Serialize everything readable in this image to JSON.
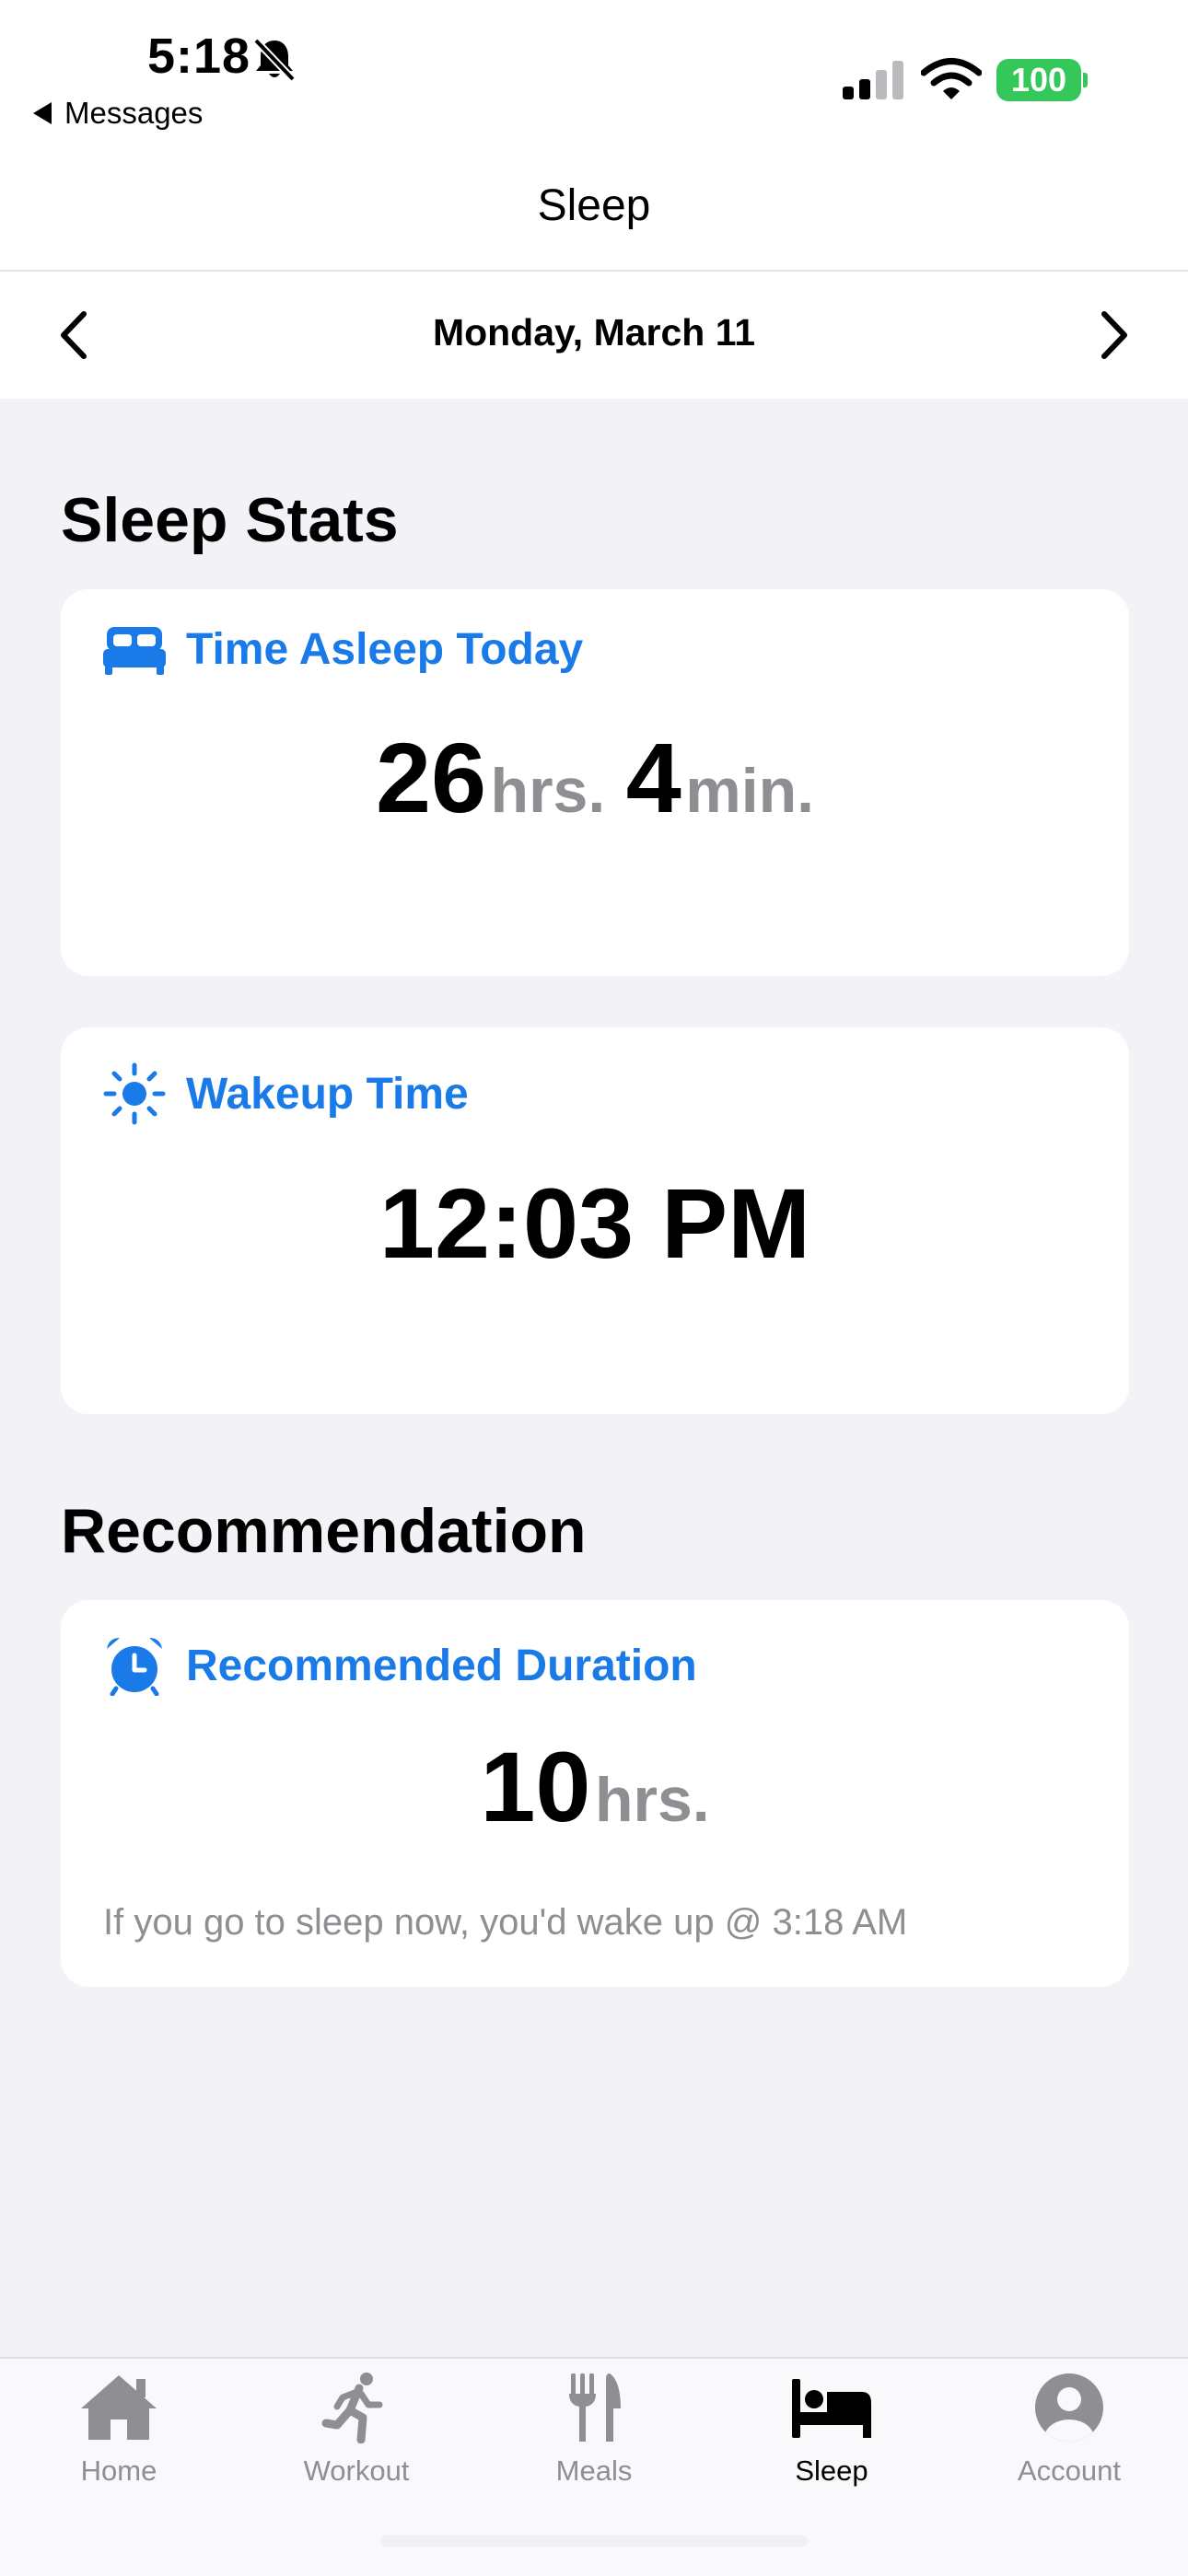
{
  "status_bar": {
    "time": "5:18",
    "back_label": "Messages",
    "battery": "100"
  },
  "nav": {
    "title": "Sleep",
    "date": "Monday, March 11"
  },
  "sleep_stats": {
    "heading": "Sleep Stats",
    "time_asleep": {
      "title": "Time Asleep Today",
      "hours": "26",
      "hours_unit": "hrs.",
      "minutes": "4",
      "minutes_unit": "min."
    },
    "wakeup": {
      "title": "Wakeup Time",
      "value": "12:03 PM"
    }
  },
  "recommendation": {
    "heading": "Recommendation",
    "title": "Recommended Duration",
    "hours": "10",
    "hours_unit": "hrs.",
    "note": "If you go to sleep now, you'd wake up @ 3:18 AM"
  },
  "tabs": [
    {
      "label": "Home",
      "icon": "house-icon",
      "active": false
    },
    {
      "label": "Workout",
      "icon": "running-figure-icon",
      "active": false
    },
    {
      "label": "Meals",
      "icon": "fork-knife-icon",
      "active": false
    },
    {
      "label": "Sleep",
      "icon": "bed-icon",
      "active": true
    },
    {
      "label": "Account",
      "icon": "person-circle-icon",
      "active": false
    }
  ],
  "colors": {
    "accent": "#1a7ae8",
    "background": "#f2f2f7",
    "secondary_text": "#8e8e93",
    "battery": "#34c759"
  }
}
